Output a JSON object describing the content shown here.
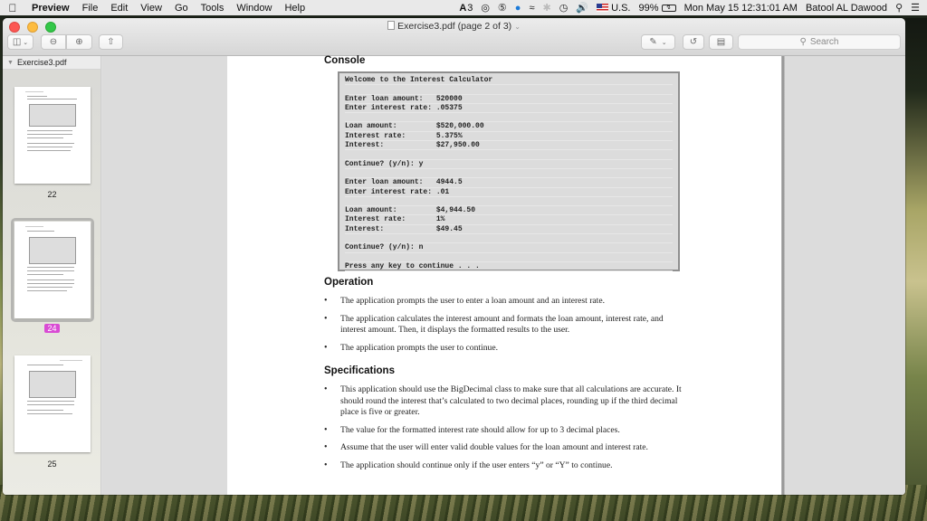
{
  "menubar": {
    "app_name": "Preview",
    "items": [
      "File",
      "Edit",
      "View",
      "Go",
      "Tools",
      "Window",
      "Help"
    ],
    "status": {
      "adobe_badge": "3",
      "input_source": "U.S.",
      "battery": "99%",
      "datetime": "Mon May 15  12:31:01 AM",
      "user": "Batool AL Dawood"
    }
  },
  "window": {
    "title": "Exercise3.pdf (page 2 of 3)",
    "search_placeholder": "Search"
  },
  "sidebar": {
    "file_name": "Exercise3.pdf",
    "thumbnails": [
      {
        "page_label": "22",
        "selected": false
      },
      {
        "page_label": "24",
        "selected": true
      },
      {
        "page_label": "25",
        "selected": false
      }
    ]
  },
  "document": {
    "console_heading": "Console",
    "console_lines": [
      "Welcome to the Interest Calculator",
      "",
      "Enter loan amount:   520000",
      "Enter interest rate: .05375",
      "",
      "Loan amount:         $520,000.00",
      "Interest rate:       5.375%",
      "Interest:            $27,950.00",
      "",
      "Continue? (y/n): y",
      "",
      "Enter loan amount:   4944.5",
      "Enter interest rate: .01",
      "",
      "Loan amount:         $4,944.50",
      "Interest rate:       1%",
      "Interest:            $49.45",
      "",
      "Continue? (y/n): n",
      "",
      "Press any key to continue . . ."
    ],
    "operation_heading": "Operation",
    "operation_bullets": [
      "The application prompts the user to enter a loan amount and an interest rate.",
      "The application calculates the interest amount and formats the loan amount, interest rate, and interest amount. Then, it displays the formatted results to the user.",
      "The application prompts the user to continue."
    ],
    "specifications_heading": "Specifications",
    "specifications_bullets": [
      "This application should use the BigDecimal class to make sure that all calculations are accurate. It should round the interest that’s calculated to two decimal places, rounding up if the third decimal place is five or greater.",
      "The value for the formatted interest rate should allow for up to 3 decimal places.",
      "Assume that the user will enter valid double values for the loan amount and interest rate.",
      "The application should continue only if the user enters “y” or “Y” to continue."
    ]
  }
}
